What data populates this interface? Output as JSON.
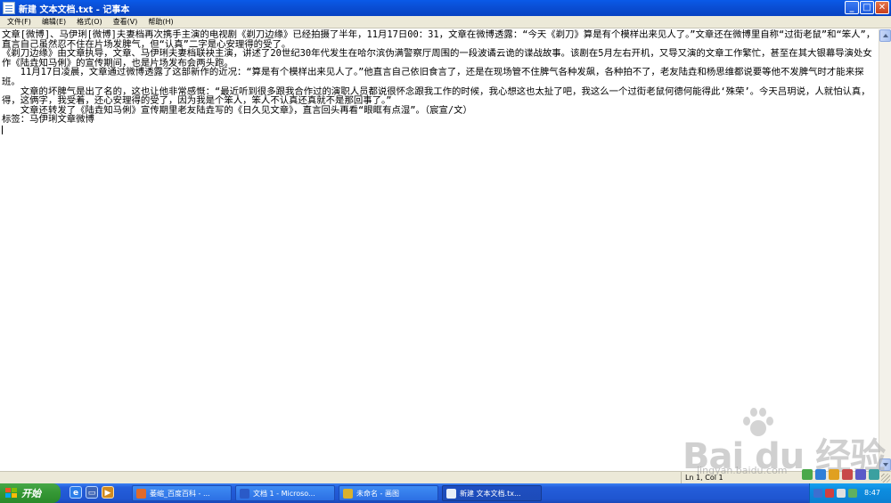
{
  "window": {
    "title": "新建 文本文档.txt - 记事本",
    "min_label": "_",
    "max_label": "□",
    "close_label": "✕"
  },
  "menu": [
    {
      "label": "文件(F)"
    },
    {
      "label": "编辑(E)"
    },
    {
      "label": "格式(O)"
    },
    {
      "label": "查看(V)"
    },
    {
      "label": "帮助(H)"
    }
  ],
  "document": {
    "lines": [
      "文章[微博]、马伊琍[微博]夫妻档再次携手主演的电视剧《剃刀边缘》已经拍摄了半年，11月17日00：31，文章在微博透露：“今天《剃刀》算是有个模样出来见人了。”文章还在微博里自称“过街老鼠”和“笨人”，直言自己虽然忍不住在片场发脾气，但“认真”二字是心安理得的受了。",
      "《剃刀边缘》由文章执导，文章、马伊琍夫妻档联袂主演，讲述了20世纪30年代发生在哈尔滨伪满警察厅周围的一段波谲云诡的谍战故事。该剧在5月左右开机，又导又演的文章工作繁忙，甚至在其大银幕导演处女作《陆垚知马俐》的宣传期间，也是片场发布会两头跑。",
      "　　11月17日凌晨，文章通过微博透露了这部新作的近况：“算是有个模样出来见人了。”他直言自己依旧食言了，还是在现场管不住脾气各种发飙，各种拍不了，老友陆垚和杨思维都说要等他不发脾气时才能来探班。",
      "　　文章的坏脾气是出了名的，这也让他非常感慨：“最近听到很多跟我合作过的演职人员都说很怀念跟我工作的时候，我心想这也太扯了吧，我这么一个过街老鼠何德何能得此‘殊荣’。今天吕玥说，人就怕认真，得，这俩字，我受着，还心安理得的受了，因为我是个笨人，笨人不认真还真就不是那回事了。”",
      "　　文章还转发了《陆垚知马俐》宣传期里老友陆垚写的《日久见文章》，直言回头再看“眼眶有点湿”。（宸宣/文）",
      "标签：马伊琍文章微博"
    ]
  },
  "statusbar": {
    "position": "Ln 1, Col 1"
  },
  "taskbar": {
    "start_label": "开始",
    "quicklaunch": [
      {
        "icon": "ie-icon",
        "glyph": "e"
      },
      {
        "icon": "show-desktop-icon",
        "glyph": "▭"
      },
      {
        "icon": "media-player-icon",
        "glyph": "▶"
      }
    ],
    "tasks": [
      {
        "label": "萎缩_百度百科 - ...",
        "icon": "browser-icon",
        "color": "#e06a2a"
      },
      {
        "label": "文档 1 - Microso...",
        "icon": "word-icon",
        "color": "#2a5ac8"
      },
      {
        "label": "未命名 - 画图",
        "icon": "paint-icon",
        "color": "#d9b12c"
      },
      {
        "label": "新建 文本文档.tx...",
        "icon": "notepad-icon",
        "color": "#e8eef8"
      }
    ],
    "clock": "8:47"
  },
  "watermark": {
    "text": "Bai du 经验",
    "sub": "jingyan.baidu.com"
  },
  "colors": {
    "titlebar": "#0a4fd6",
    "taskbar": "#245edb",
    "start": "#379a37",
    "tray": "#0d8ee0"
  }
}
